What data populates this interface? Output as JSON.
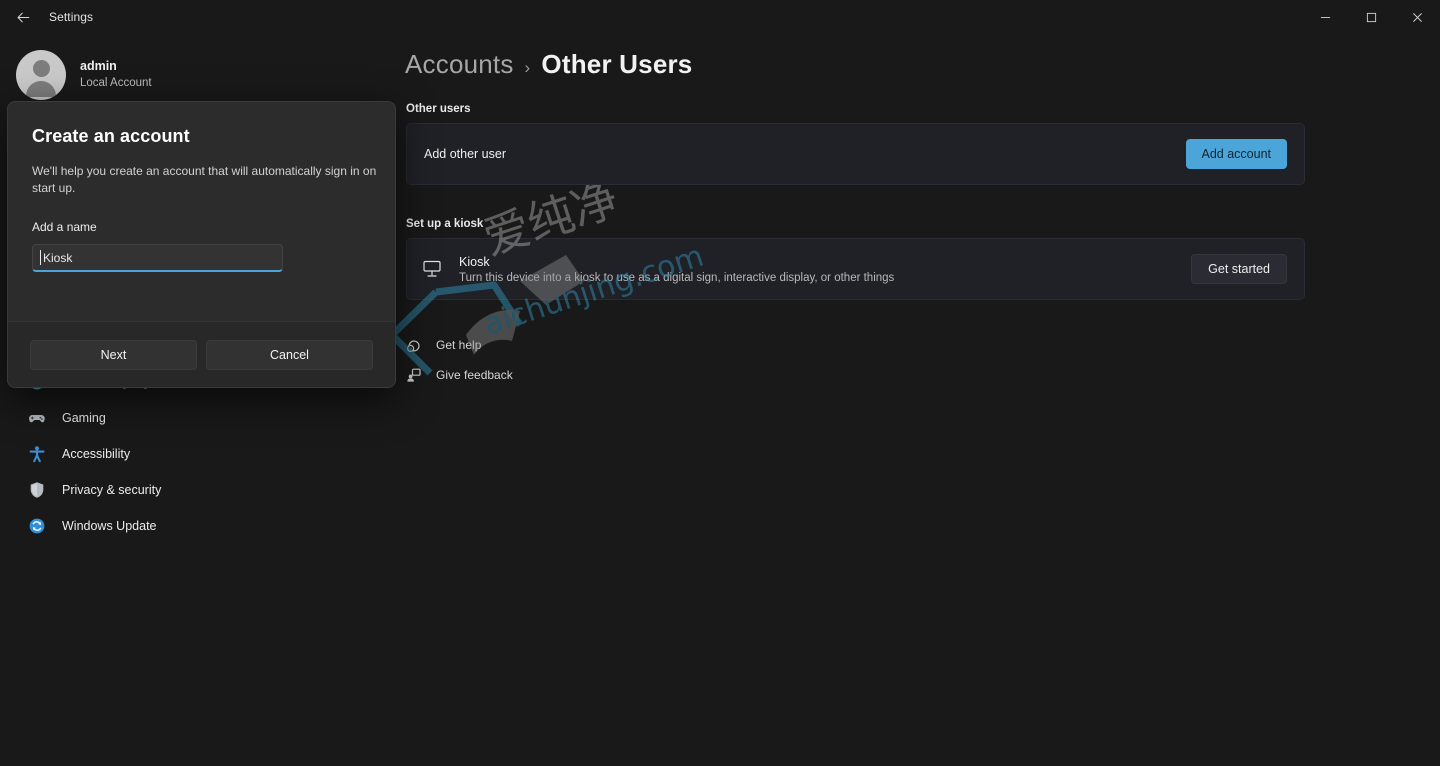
{
  "titlebar": {
    "back_icon": "back-arrow-icon",
    "title": "Settings",
    "minimize": "minimize-icon",
    "maximize": "maximize-icon",
    "close": "close-icon"
  },
  "sidebar": {
    "account": {
      "name": "admin",
      "subtitle": "Local Account",
      "avatar": "user-avatar"
    },
    "items": [
      {
        "label": "Time & language",
        "icon": "clock-icon",
        "color": "#4fb3c4"
      },
      {
        "label": "Gaming",
        "icon": "gamepad-icon",
        "color": "#b7bcc4"
      },
      {
        "label": "Accessibility",
        "icon": "accessibility-icon",
        "color": "#3b8fd4"
      },
      {
        "label": "Privacy & security",
        "icon": "shield-icon",
        "color": "#b7bcc4"
      },
      {
        "label": "Windows Update",
        "icon": "update-icon",
        "color": "#2f8fd8"
      }
    ]
  },
  "main": {
    "breadcrumb": {
      "parent": "Accounts",
      "separator": "›",
      "current": "Other Users"
    },
    "other_users": {
      "section_label": "Other users",
      "row_label": "Add other user",
      "button_label": "Add account",
      "button_color": "#4ca5d8"
    },
    "kiosk": {
      "section_label": "Set up a kiosk",
      "icon": "kiosk-display-icon",
      "title": "Kiosk",
      "description": "Turn this device into a kiosk to use as a digital sign, interactive display, or other things",
      "button_label": "Get started"
    },
    "links": [
      {
        "label": "Get help",
        "icon": "help-icon"
      },
      {
        "label": "Give feedback",
        "icon": "feedback-icon"
      }
    ]
  },
  "watermark": {
    "text_latin": "aichunjing.com",
    "text_cjk": "爱纯净",
    "color": "#2f8fb5"
  },
  "dialog": {
    "title": "Create an account",
    "description": "We'll help you create an account that will automatically sign in on start up.",
    "field_label": "Add a name",
    "field_value": "Kiosk",
    "field_placeholder": "",
    "primary_label": "Next",
    "secondary_label": "Cancel"
  }
}
